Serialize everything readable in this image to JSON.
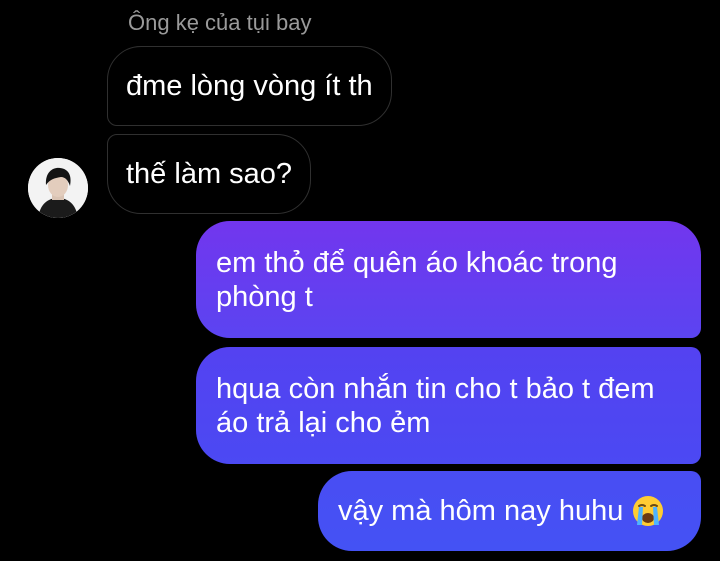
{
  "thread": {
    "sender_name": "Ông kẹ của tụi bay",
    "messages": [
      {
        "from": "them",
        "text": "đme lòng vòng ít th"
      },
      {
        "from": "them",
        "text": "thế làm sao?"
      },
      {
        "from": "me",
        "text": "em thỏ để quên áo khoác trong phòng t"
      },
      {
        "from": "me",
        "text": "hqua còn nhắn tin cho t bảo t đem áo trả lại cho ẻm"
      },
      {
        "from": "me",
        "text": "vậy mà hôm nay huhu"
      }
    ],
    "last_message_emoji": "loudly-crying-face-icon"
  },
  "colors": {
    "background": "#000000",
    "incoming_bubble_border": "#303030",
    "outgoing_gradient_top": "#7236ee",
    "outgoing_gradient_bottom": "#4452f4",
    "sender_name": "#9a9a9a"
  }
}
